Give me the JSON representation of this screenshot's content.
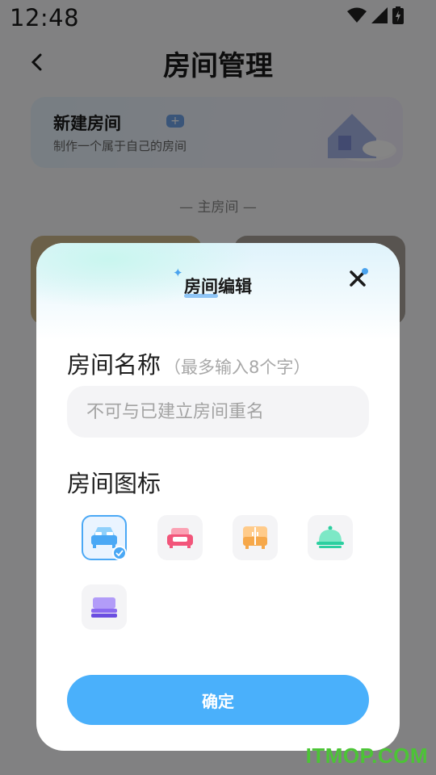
{
  "status_bar": {
    "time": "12:48"
  },
  "nav": {
    "title": "房间管理"
  },
  "new_room_card": {
    "title": "新建房间",
    "subtitle": "制作一个属于自己的房间"
  },
  "section": {
    "label": "— 主房间 —"
  },
  "dialog": {
    "title": "房间编辑",
    "name_label": "房间名称",
    "name_hint": "（最多输入8个字）",
    "name_placeholder": "不可与已建立房间重名",
    "icon_label": "房间图标",
    "icons": [
      {
        "name": "bed-icon",
        "selected": true,
        "color": "#4aa8f5"
      },
      {
        "name": "sofa-icon",
        "selected": false,
        "color": "#f2557a"
      },
      {
        "name": "wardrobe-icon",
        "selected": false,
        "color": "#f6a84a"
      },
      {
        "name": "dining-cloche-icon",
        "selected": false,
        "color": "#2ccfa0"
      },
      {
        "name": "storage-box-icon",
        "selected": false,
        "color": "#8a6af0"
      }
    ],
    "confirm_label": "确定"
  },
  "watermark": "ITMOP.COM",
  "colors": {
    "accent": "#4ab0fb",
    "overlay": "rgba(0,0,0,0.48)"
  }
}
